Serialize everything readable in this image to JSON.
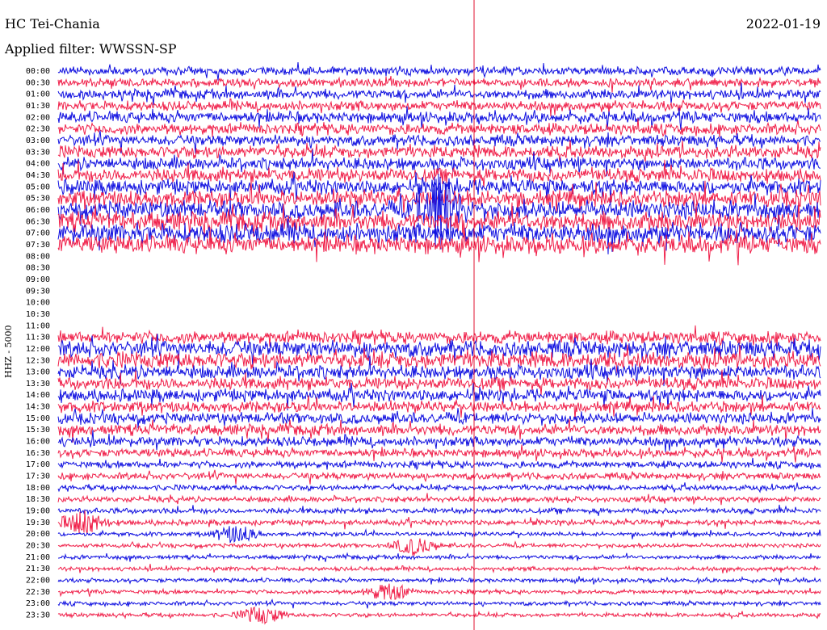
{
  "header": {
    "station": "HC Tei-Chania",
    "filter": "Applied filter: WWSSN-SP",
    "date": "2022-01-19",
    "channel": "HHZ - 5000"
  },
  "chart_data": {
    "type": "line",
    "title": "HC Tei-Chania",
    "subtitle": "Applied filter: WWSSN-SP",
    "ylabel": "HHZ - 5000",
    "grid": false,
    "colors": [
      "#1010e0",
      "#f0204a"
    ],
    "marker_color": "#e01030",
    "tick_labels": [
      "00:00",
      "00:30",
      "01:00",
      "01:30",
      "02:00",
      "02:30",
      "03:00",
      "03:30",
      "04:00",
      "04:30",
      "05:00",
      "05:30",
      "06:00",
      "06:30",
      "07:00",
      "07:30",
      "08:00",
      "08:30",
      "09:00",
      "09:30",
      "10:00",
      "10:30",
      "11:00",
      "11:30",
      "12:00",
      "12:30",
      "13:00",
      "13:30",
      "14:00",
      "14:30",
      "15:00",
      "15:30",
      "16:00",
      "16:30",
      "17:00",
      "17:30",
      "18:00",
      "18:30",
      "19:00",
      "19:30",
      "20:00",
      "20:30",
      "21:00",
      "21:30",
      "22:00",
      "22:30",
      "23:00",
      "23:30"
    ],
    "amplitude": [
      6,
      6,
      7,
      7,
      8,
      8,
      8,
      9,
      9,
      10,
      11,
      12,
      13,
      14,
      14,
      13,
      0,
      0,
      0,
      0,
      0,
      0,
      0,
      9,
      12,
      12,
      10,
      9,
      9,
      8,
      8,
      8,
      7,
      6,
      5,
      5,
      4,
      4,
      4,
      4,
      3,
      3,
      3,
      3,
      3,
      3,
      3,
      3
    ],
    "data_gaps": [
      {
        "trace": "07:30",
        "from_min": 0,
        "to_min": 0
      },
      {
        "trace": "08:00",
        "from_min": 0,
        "to_min": 30
      },
      {
        "trace": "08:30",
        "from_min": 0,
        "to_min": 30
      },
      {
        "trace": "09:00",
        "from_min": 0,
        "to_min": 30
      },
      {
        "trace": "09:30",
        "from_min": 0,
        "to_min": 30
      },
      {
        "trace": "10:00",
        "from_min": 0,
        "to_min": 30
      },
      {
        "trace": "10:30",
        "from_min": 0,
        "to_min": 30
      },
      {
        "trace": "11:00",
        "from_min": 0,
        "to_min": 30
      }
    ],
    "events": [
      {
        "trace": "06:00",
        "minute": 15
      },
      {
        "trace": "19:30",
        "minute": 1
      },
      {
        "trace": "20:00",
        "minute": 7
      },
      {
        "trace": "20:30",
        "minute": 14
      },
      {
        "trace": "22:30",
        "minute": 13
      },
      {
        "trace": "23:30",
        "minute": 8
      }
    ]
  }
}
